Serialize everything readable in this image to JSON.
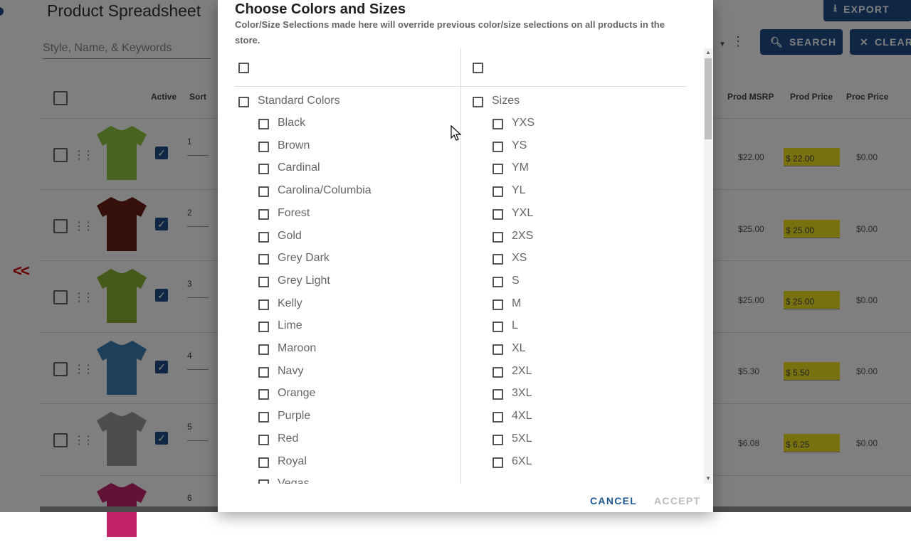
{
  "background": {
    "title": "Product Spreadsheet",
    "search_placeholder": "Style, Name, & Keywords",
    "export_label": "EXPORT",
    "search_label": "SEARCH",
    "clear_label": "CLEAR",
    "headers": {
      "active": "Active",
      "sort": "Sort",
      "prod_msrp": "Prod MSRP",
      "prod_price": "Prod Price",
      "proc_price": "Proc Price"
    },
    "nav_arrows": "<<",
    "rows": [
      {
        "sort": "1",
        "msrp": "$22.00",
        "price": "$ 22.00",
        "proc": "$0.00",
        "shirt_color": "#8cc63f"
      },
      {
        "sort": "2",
        "msrp": "$25.00",
        "price": "$ 25.00",
        "proc": "$0.00",
        "shirt_color": "#6b2015"
      },
      {
        "sort": "3",
        "msrp": "$25.00",
        "price": "$ 25.00",
        "proc": "$0.00",
        "shirt_color": "#8ab534"
      },
      {
        "sort": "4",
        "msrp": "$5.30",
        "price": "$ 5.50",
        "proc": "$0.00",
        "shirt_color": "#3a7fb5"
      },
      {
        "sort": "5",
        "msrp": "$6.08",
        "price": "$ 6.25",
        "proc": "$0.00",
        "shirt_color": "#9a9a9a"
      },
      {
        "sort": "6",
        "shirt_color": "#c2246a"
      }
    ]
  },
  "dialog": {
    "title": "Choose Colors and Sizes",
    "subtitle": "Color/Size Selections made here will override previous color/size selections on all products in the store.",
    "colors_group": "Standard Colors",
    "colors": [
      "Black",
      "Brown",
      "Cardinal",
      "Carolina/Columbia",
      "Forest",
      "Gold",
      "Grey Dark",
      "Grey Light",
      "Kelly",
      "Lime",
      "Maroon",
      "Navy",
      "Orange",
      "Purple",
      "Red",
      "Royal",
      "Vegas"
    ],
    "sizes_group": "Sizes",
    "sizes": [
      "YXS",
      "YS",
      "YM",
      "YL",
      "YXL",
      "2XS",
      "XS",
      "S",
      "M",
      "L",
      "XL",
      "2XL",
      "3XL",
      "4XL",
      "5XL",
      "6XL"
    ],
    "cancel_label": "CANCEL",
    "accept_label": "ACCEPT"
  }
}
